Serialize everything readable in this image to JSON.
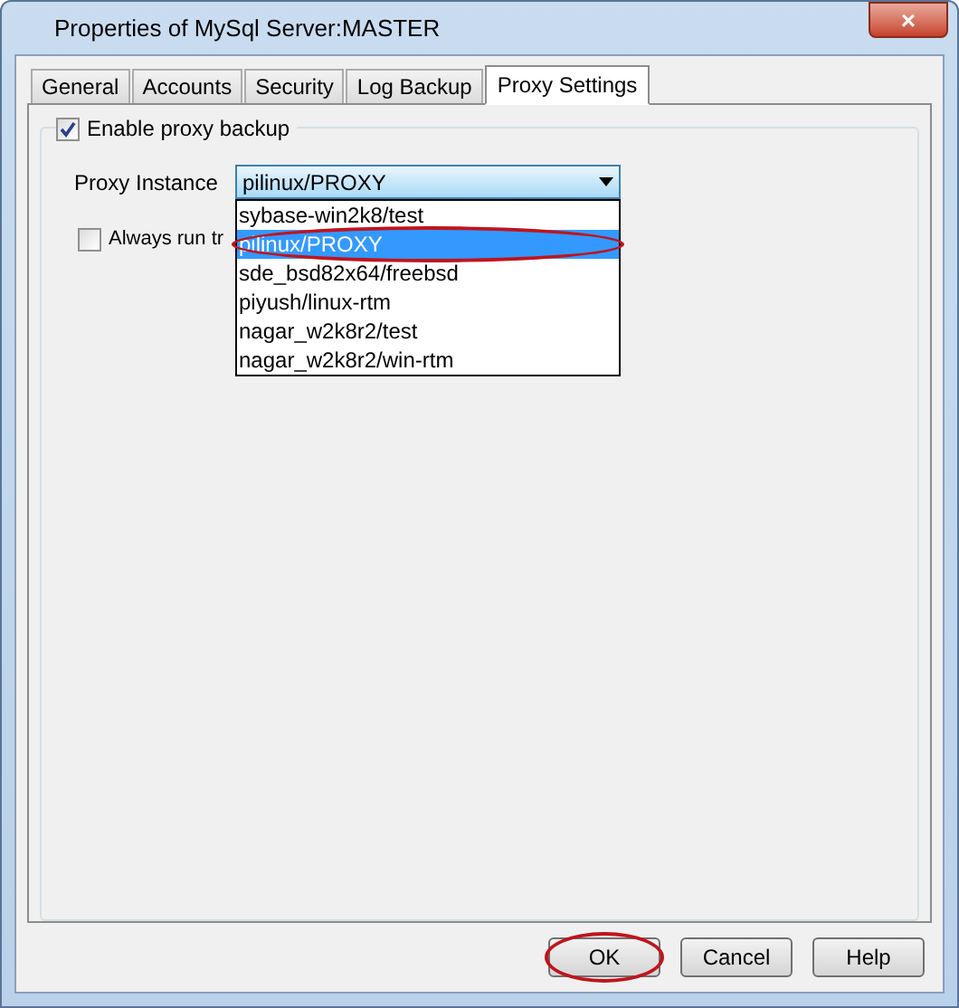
{
  "window": {
    "title": "Properties of MySql Server:MASTER",
    "close": "×"
  },
  "tabs": [
    {
      "label": "General",
      "selected": false
    },
    {
      "label": "Accounts",
      "selected": false
    },
    {
      "label": "Security",
      "selected": false
    },
    {
      "label": "Log Backup",
      "selected": false
    },
    {
      "label": "Proxy Settings",
      "selected": true
    }
  ],
  "enable_proxy": {
    "label": "Enable proxy backup",
    "checked": true
  },
  "proxy_instance": {
    "label": "Proxy Instance",
    "value": "pilinux/PROXY",
    "expanded": true,
    "options": [
      {
        "label": "sybase-win2k8/test",
        "selected": false,
        "highlighted": false
      },
      {
        "label": "pilinux/PROXY",
        "selected": true,
        "highlighted": true
      },
      {
        "label": "sde_bsd82x64/freebsd",
        "selected": false,
        "highlighted": false
      },
      {
        "label": "piyush/linux-rtm",
        "selected": false,
        "highlighted": false
      },
      {
        "label": "nagar_w2k8r2/test",
        "selected": false,
        "highlighted": false
      },
      {
        "label": "nagar_w2k8r2/win-rtm",
        "selected": false,
        "highlighted": false
      }
    ]
  },
  "always_run": {
    "label": "Always run tr",
    "checked": false
  },
  "buttons": [
    {
      "label": "OK",
      "highlighted": true
    },
    {
      "label": "Cancel",
      "highlighted": false
    },
    {
      "label": "Help",
      "highlighted": false
    }
  ]
}
